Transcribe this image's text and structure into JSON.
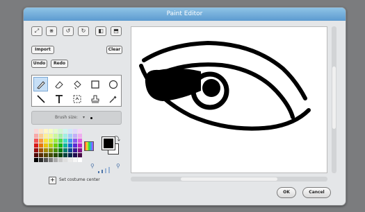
{
  "window": {
    "title": "Paint Editor"
  },
  "toolbar": {
    "icons": [
      "grow-icon",
      "shrink-icon",
      "rotate-left-icon",
      "rotate-right-icon",
      "flip-horizontal-icon",
      "flip-vertical-icon"
    ],
    "import_label": "Import",
    "clear_label": "Clear",
    "undo_label": "Undo",
    "redo_label": "Redo"
  },
  "paint_tools": [
    {
      "name": "brush-tool",
      "selected": true
    },
    {
      "name": "eraser-tool",
      "selected": false
    },
    {
      "name": "fill-tool",
      "selected": false
    },
    {
      "name": "rectangle-tool",
      "selected": false
    },
    {
      "name": "ellipse-tool",
      "selected": false
    },
    {
      "name": "line-tool",
      "selected": false
    },
    {
      "name": "text-tool",
      "selected": false
    },
    {
      "name": "select-tool",
      "selected": false
    },
    {
      "name": "stamp-tool",
      "selected": false
    },
    {
      "name": "eyedropper-tool",
      "selected": false
    }
  ],
  "brush": {
    "label": "Brush size:"
  },
  "colors": {
    "foreground": "#000000",
    "background": "#ffffff",
    "palette": [
      "#fbd6d6",
      "#fde6c8",
      "#fff6c4",
      "#f7fbc4",
      "#e6fbc8",
      "#d2f7d2",
      "#cdf6ef",
      "#d1e6fb",
      "#e1d6fb",
      "#f6d6f7",
      "#f8a8a8",
      "#fbcc93",
      "#fdf097",
      "#eef897",
      "#ccf79b",
      "#a4efa4",
      "#a1efe3",
      "#a3cbf8",
      "#c3adf8",
      "#eeadef",
      "#f25555",
      "#f79b3d",
      "#fbe43a",
      "#d9f03b",
      "#9aeb3f",
      "#4fdc4f",
      "#44dcc6",
      "#4596ef",
      "#8a5cef",
      "#df5ee0",
      "#d81919",
      "#e6770c",
      "#eac50d",
      "#b6cf0d",
      "#6ccc0d",
      "#18b518",
      "#0fb59d",
      "#1769d1",
      "#5b2ad3",
      "#bf24c1",
      "#961010",
      "#a15207",
      "#a38a08",
      "#7f9008",
      "#4b8f08",
      "#0d7f0d",
      "#087f6d",
      "#0c4892",
      "#3b1793",
      "#851587",
      "#500808",
      "#552a04",
      "#564904",
      "#434c04",
      "#284b04",
      "#064306",
      "#04433a",
      "#06264d",
      "#1f0c4e",
      "#460b47",
      "#000000",
      "#2a2a2a",
      "#555555",
      "#7f7f7f",
      "#aaaaaa",
      "#c8c8c8",
      "#dedede",
      "#ebebeb",
      "#f6f6f6",
      "#ffffff"
    ]
  },
  "set_center": {
    "label": "Set costume center"
  },
  "footer": {
    "ok_label": "OK",
    "cancel_label": "Cancel"
  }
}
